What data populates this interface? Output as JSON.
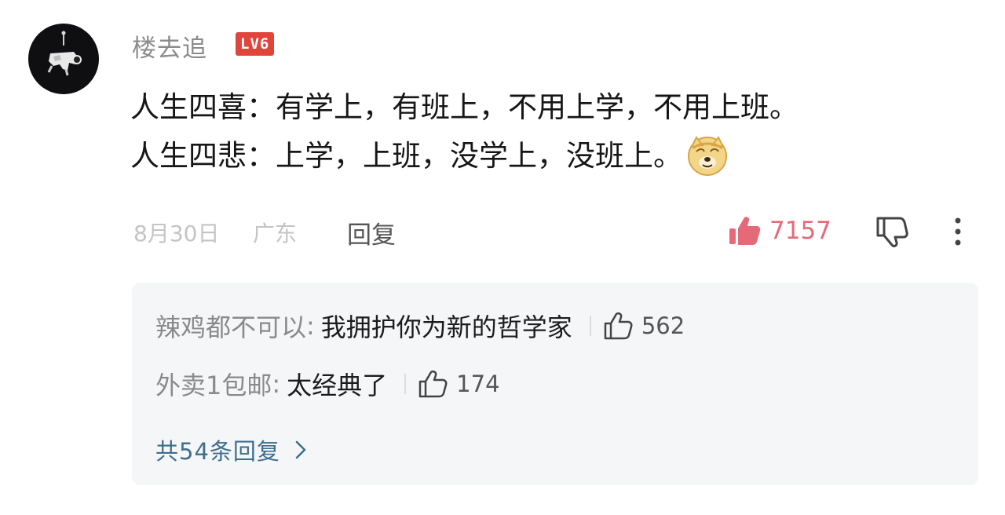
{
  "comment": {
    "username": "楼去追",
    "level_badge": "LV6",
    "lines": [
      "人生四喜：有学上，有班上，不用上学，不用上班。",
      "人生四悲：上学，上班，没学上，没班上。"
    ],
    "emoji": "doge-emoji",
    "date": "8月30日",
    "location": "广东",
    "reply_label": "回复",
    "like_count": "7157"
  },
  "replies": {
    "items": [
      {
        "author": "辣鸡都不可以",
        "separator": ":",
        "content": "我拥护你为新的哲学家",
        "like_count": "562"
      },
      {
        "author": "外卖1包邮",
        "separator": ":",
        "content": "太经典了",
        "like_count": "174"
      }
    ],
    "view_all_label": "共54条回复"
  },
  "icons": {
    "like": "thumbs-up-filled-icon",
    "dislike": "thumbs-down-outline-icon",
    "more": "more-vertical-icon",
    "reply_like": "thumbs-up-outline-icon",
    "view_all": "chevron-right-icon"
  },
  "colors": {
    "like_active": "#e46a79",
    "level_badge": "#e0453c",
    "view_all_link": "#3f6d8c",
    "replies_background": "#f5f6f8",
    "muted_text": "#8a8a8a"
  }
}
